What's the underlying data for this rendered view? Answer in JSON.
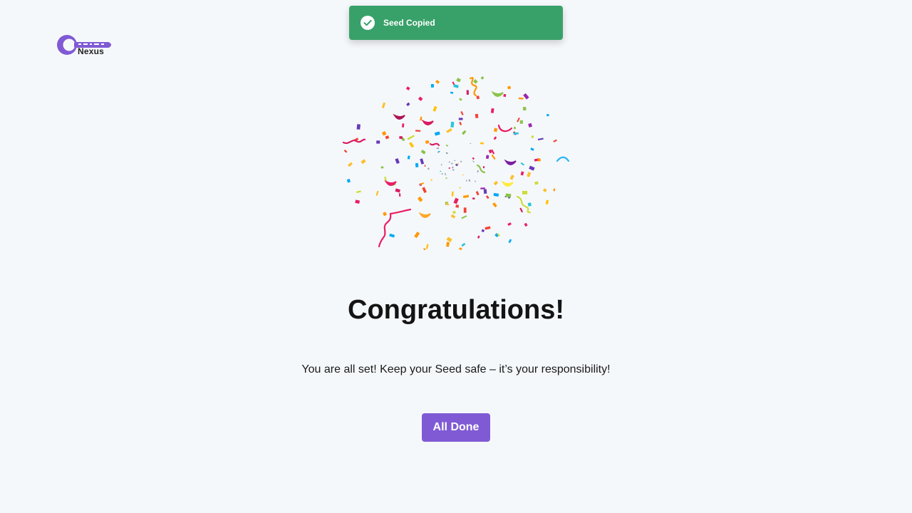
{
  "brand": {
    "name": "Nexus",
    "logo_icon": "key-icon",
    "accent_color": "#805ad5"
  },
  "toast": {
    "message": "Seed Copied",
    "icon": "check-circle-icon",
    "color": "#38a169"
  },
  "main": {
    "illustration": "confetti",
    "headline": "Congratulations!",
    "subtext": "You are all set! Keep your Seed safe – it’s your responsibility!",
    "done_label": "All Done"
  }
}
